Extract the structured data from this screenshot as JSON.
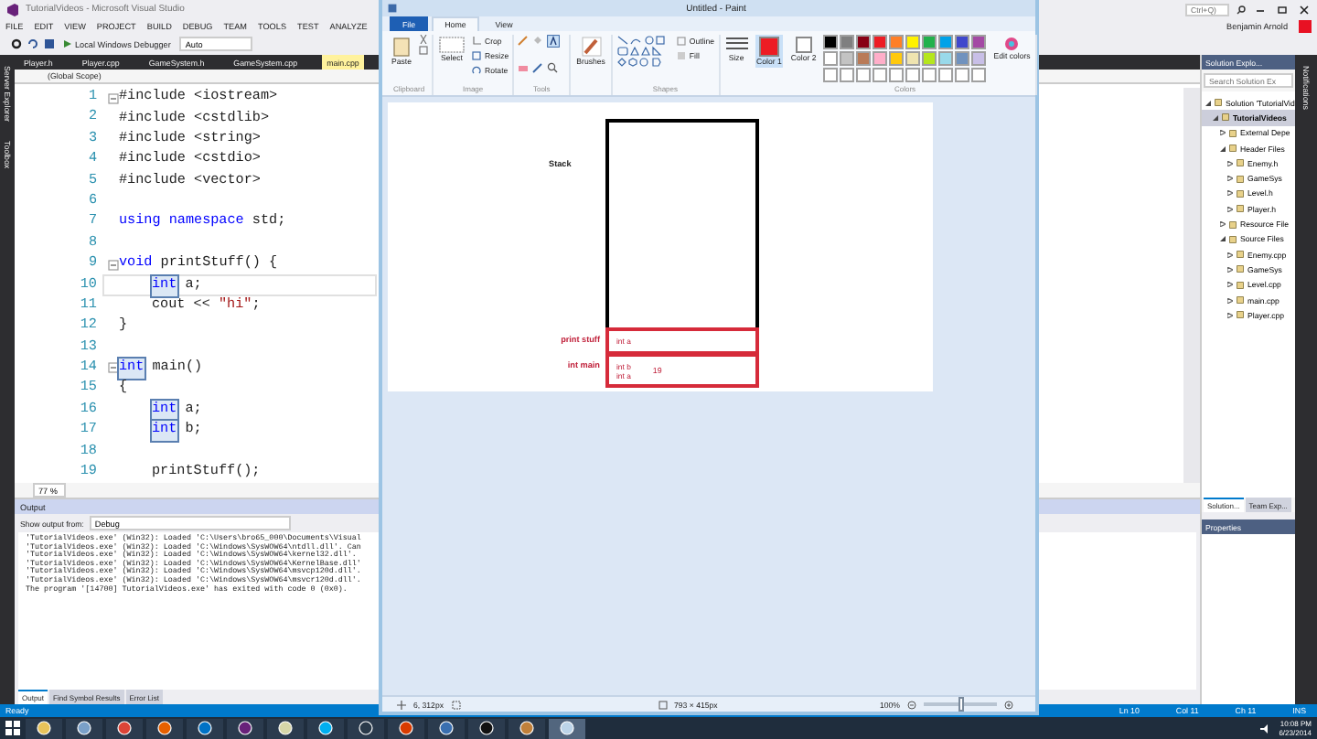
{
  "vs": {
    "title": "TutorialVideos - Microsoft Visual Studio",
    "quick_launch": "Ctrl+Q)",
    "user": "Benjamin Arnold",
    "menu": [
      "FILE",
      "EDIT",
      "VIEW",
      "PROJECT",
      "BUILD",
      "DEBUG",
      "TEAM",
      "TOOLS",
      "TEST",
      "ANALYZE"
    ],
    "toolbar": {
      "debugger": "Local Windows Debugger",
      "config": "Auto"
    },
    "side_tabs": [
      "Server Explorer",
      "Toolbox"
    ],
    "doc_tabs": [
      {
        "label": "Player.h",
        "selected": false
      },
      {
        "label": "Player.cpp",
        "selected": false
      },
      {
        "label": "GameSystem.h",
        "selected": false
      },
      {
        "label": "GameSystem.cpp",
        "selected": false
      },
      {
        "label": "main.cpp",
        "selected": true
      }
    ],
    "scope": "(Global Scope)",
    "code": [
      {
        "number": "1",
        "fold": true,
        "current": false,
        "parts": [
          {
            "kind": "plain",
            "text": "#include <iostream>",
            "highlighted": false
          }
        ]
      },
      {
        "number": "2",
        "fold": false,
        "current": false,
        "parts": [
          {
            "kind": "plain",
            "text": "#include <cstdlib>",
            "highlighted": false
          }
        ]
      },
      {
        "number": "3",
        "fold": false,
        "current": false,
        "parts": [
          {
            "kind": "plain",
            "text": "#include <string>",
            "highlighted": false
          }
        ]
      },
      {
        "number": "4",
        "fold": false,
        "current": false,
        "parts": [
          {
            "kind": "plain",
            "text": "#include <cstdio>",
            "highlighted": false
          }
        ]
      },
      {
        "number": "5",
        "fold": false,
        "current": false,
        "parts": [
          {
            "kind": "plain",
            "text": "#include <vector>",
            "highlighted": false
          }
        ]
      },
      {
        "number": "6",
        "fold": false,
        "current": false
      },
      {
        "number": "7",
        "fold": false,
        "current": false,
        "parts": [
          {
            "kind": "keyword",
            "text": "using namespace",
            "highlighted": false
          },
          {
            "kind": "plain",
            "text": " std;",
            "highlighted": false
          }
        ]
      },
      {
        "number": "8",
        "fold": false,
        "current": false
      },
      {
        "number": "9",
        "fold": true,
        "current": false,
        "parts": [
          {
            "kind": "keyword",
            "text": "void",
            "highlighted": false
          },
          {
            "kind": "plain",
            "text": " printStuff() {",
            "highlighted": false
          }
        ]
      },
      {
        "number": "10",
        "fold": false,
        "current": true,
        "indented": true,
        "parts": [
          {
            "kind": "keyword",
            "text": "int",
            "highlighted": true
          },
          {
            "kind": "plain",
            "text": " a;",
            "highlighted": false
          }
        ]
      },
      {
        "number": "11",
        "fold": false,
        "current": false,
        "indented": true,
        "parts": [
          {
            "kind": "plain",
            "text": "cout << ",
            "highlighted": false
          },
          {
            "kind": "string",
            "text": "\"hi\"",
            "highlighted": false
          },
          {
            "kind": "plain",
            "text": ";",
            "highlighted": false
          }
        ]
      },
      {
        "number": "12",
        "fold": false,
        "current": false,
        "parts": [
          {
            "kind": "plain",
            "text": "}",
            "highlighted": false
          }
        ]
      },
      {
        "number": "13",
        "fold": false,
        "current": false
      },
      {
        "number": "14",
        "fold": true,
        "current": false,
        "parts": [
          {
            "kind": "keyword",
            "text": "int",
            "highlighted": true
          },
          {
            "kind": "plain",
            "text": " main()",
            "highlighted": false
          }
        ]
      },
      {
        "number": "15",
        "fold": false,
        "current": false,
        "parts": [
          {
            "kind": "plain",
            "text": "{",
            "highlighted": false
          }
        ]
      },
      {
        "number": "16",
        "fold": false,
        "current": false,
        "indented": true,
        "parts": [
          {
            "kind": "keyword",
            "text": "int",
            "highlighted": true
          },
          {
            "kind": "plain",
            "text": " a;",
            "highlighted": false
          }
        ]
      },
      {
        "number": "17",
        "fold": false,
        "current": false,
        "indented": true,
        "parts": [
          {
            "kind": "keyword",
            "text": "int",
            "highlighted": true
          },
          {
            "kind": "plain",
            "text": " b;",
            "highlighted": false
          }
        ]
      },
      {
        "number": "18",
        "fold": false,
        "current": false
      },
      {
        "number": "19",
        "fold": false,
        "current": false,
        "indented": true,
        "parts": [
          {
            "kind": "plain",
            "text": "printStuff();",
            "highlighted": false
          }
        ]
      }
    ],
    "zoom": "77 %",
    "output": {
      "title": "Output",
      "source_label": "Show output from:",
      "source": "Debug",
      "lines": [
        "'TutorialVideos.exe' (Win32): Loaded 'C:\\Users\\bro65_000\\Documents\\Visual",
        "'TutorialVideos.exe' (Win32): Loaded 'C:\\Windows\\SysWOW64\\ntdll.dll'. Can",
        "'TutorialVideos.exe' (Win32): Loaded 'C:\\Windows\\SysWOW64\\kernel32.dll'.",
        "'TutorialVideos.exe' (Win32): Loaded 'C:\\Windows\\SysWOW64\\KernelBase.dll'",
        "'TutorialVideos.exe' (Win32): Loaded 'C:\\Windows\\SysWOW64\\msvcp120d.dll'.",
        "'TutorialVideos.exe' (Win32): Loaded 'C:\\Windows\\SysWOW64\\msvcr120d.dll'.",
        "The program '[14700] TutorialVideos.exe' has exited with code 0 (0x0)."
      ],
      "tabs": [
        {
          "label": "Output",
          "selected": true
        },
        {
          "label": "Find Symbol Results",
          "selected": false
        },
        {
          "label": "Error List",
          "selected": false
        }
      ]
    },
    "solution_explorer": {
      "title": "Solution Explo...",
      "search": "Search Solution Ex",
      "tree": [
        {
          "label": "Solution 'TutorialVid",
          "expanded": true,
          "selected": false,
          "children": [
            {
              "label": "TutorialVideos",
              "expanded": true,
              "selected": true,
              "children": [
                {
                  "label": "External Depe",
                  "expanded": false,
                  "selected": false
                },
                {
                  "label": "Header Files",
                  "expanded": true,
                  "selected": false,
                  "children": [
                    {
                      "label": "Enemy.h",
                      "expanded": false,
                      "selected": false
                    },
                    {
                      "label": "GameSys",
                      "expanded": false,
                      "selected": false
                    },
                    {
                      "label": "Level.h",
                      "expanded": false,
                      "selected": false
                    },
                    {
                      "label": "Player.h",
                      "expanded": false,
                      "selected": false
                    }
                  ]
                },
                {
                  "label": "Resource File",
                  "expanded": false,
                  "selected": false
                },
                {
                  "label": "Source Files",
                  "expanded": true,
                  "selected": false,
                  "children": [
                    {
                      "label": "Enemy.cpp",
                      "expanded": false,
                      "selected": false
                    },
                    {
                      "label": "GameSys",
                      "expanded": false,
                      "selected": false
                    },
                    {
                      "label": "Level.cpp",
                      "expanded": false,
                      "selected": false
                    },
                    {
                      "label": "main.cpp",
                      "expanded": false,
                      "selected": false
                    },
                    {
                      "label": "Player.cpp",
                      "expanded": false,
                      "selected": false
                    }
                  ]
                }
              ]
            }
          ]
        }
      ],
      "tabs": [
        {
          "label": "Solution...",
          "selected": true
        },
        {
          "label": "Team Exp...",
          "selected": false
        }
      ]
    },
    "properties": {
      "title": "Properties"
    },
    "notifications": "Notifications",
    "status": {
      "text": "Ready",
      "ln": "Ln 10",
      "col": "Col 11",
      "ch": "Ch 11",
      "mode": "INS"
    }
  },
  "paint": {
    "title": "Untitled - Paint",
    "file_menu": "File",
    "tabs": [
      {
        "label": "Home",
        "selected": true
      },
      {
        "label": "View",
        "selected": false
      }
    ],
    "groups": {
      "clipboard": "Clipboard",
      "image": "Image",
      "tools": "Tools",
      "shapes": "Shapes",
      "colors": "Colors"
    },
    "buttons": {
      "paste": "Paste",
      "select": "Select",
      "crop": "Crop",
      "resize": "Resize",
      "rotate": "Rotate",
      "brushes": "Brushes",
      "outline": "Outline",
      "fill": "Fill",
      "size": "Size",
      "edit_colors": "Edit colors"
    },
    "color_buttons": [
      {
        "label": "Color 1",
        "color": "#ed1c24",
        "selected": true
      },
      {
        "label": "Color 2",
        "color": "#ffffff",
        "selected": false
      }
    ],
    "palette": [
      {
        "color": "#000000"
      },
      {
        "color": "#7f7f7f"
      },
      {
        "color": "#880015"
      },
      {
        "color": "#ed1c24"
      },
      {
        "color": "#ff7f27"
      },
      {
        "color": "#fff200"
      },
      {
        "color": "#22b14c"
      },
      {
        "color": "#00a2e8"
      },
      {
        "color": "#3f48cc"
      },
      {
        "color": "#a349a4"
      },
      {
        "color": "#ffffff"
      },
      {
        "color": "#c3c3c3"
      },
      {
        "color": "#b97a57"
      },
      {
        "color": "#ffaec9"
      },
      {
        "color": "#ffc90e"
      },
      {
        "color": "#efe4b0"
      },
      {
        "color": "#b5e61d"
      },
      {
        "color": "#99d9ea"
      },
      {
        "color": "#7092be"
      },
      {
        "color": "#c8bfe7"
      }
    ],
    "canvas": {
      "stack_label": "Stack",
      "frames": [
        {
          "label": "print stuff",
          "vars": [
            "int a"
          ]
        },
        {
          "label": "int main",
          "vars": [
            "int b",
            "int a"
          ],
          "value": "19"
        }
      ]
    },
    "status": {
      "position": "6, 312px",
      "size": "793 × 415px",
      "zoom": "100%",
      "level": 0.5
    }
  },
  "taskbar": {
    "apps": [
      {
        "color": "#e8c35a",
        "selected": false
      },
      {
        "color": "#7aa0c8",
        "selected": false
      },
      {
        "color": "#db4437",
        "selected": false
      },
      {
        "color": "#e66000",
        "selected": false
      },
      {
        "color": "#0072c6",
        "selected": false
      },
      {
        "color": "#68217a",
        "selected": false
      },
      {
        "color": "#d6d6a8",
        "selected": false
      },
      {
        "color": "#00aff0",
        "selected": false
      },
      {
        "color": "#2a3a4a",
        "selected": false
      },
      {
        "color": "#d83b01",
        "selected": false
      },
      {
        "color": "#3a6fb0",
        "selected": false
      },
      {
        "color": "#111111",
        "selected": false
      },
      {
        "color": "#c0803a",
        "selected": false
      },
      {
        "color": "#bcd4e8",
        "selected": true
      }
    ],
    "time": "10:08 PM",
    "date": "6/23/2014"
  }
}
